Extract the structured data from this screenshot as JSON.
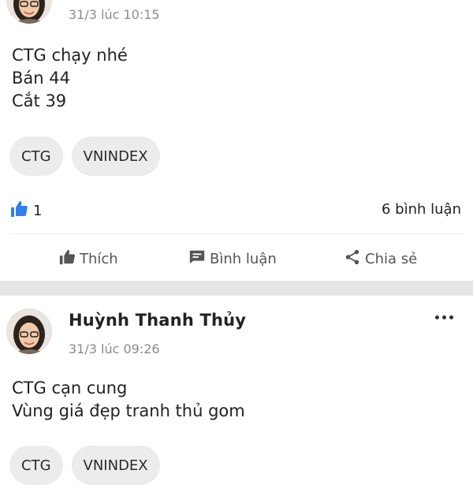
{
  "posts": [
    {
      "time": "31/3 lúc 10:15",
      "content_lines": [
        "CTG chạy nhé",
        "Bán 44",
        "Cắt 39"
      ],
      "tags": [
        "CTG",
        "VNINDEX"
      ],
      "like_count": "1",
      "comment_count": "6 bình luận",
      "actions": {
        "like": "Thích",
        "comment": "Bình luận",
        "share": "Chia sẻ"
      }
    },
    {
      "author": "Huỳnh Thanh Thủy",
      "time": "31/3 lúc 09:26",
      "content_lines": [
        "CTG cạn cung",
        "Vùng giá đẹp tranh thủ gom"
      ],
      "tags": [
        "CTG",
        "VNINDEX"
      ]
    }
  ],
  "icons": {
    "like": "thumbs-up-icon",
    "comment": "comment-icon",
    "share": "share-icon",
    "more": "more-options-icon"
  },
  "colors": {
    "like_accent": "#2f80ed",
    "action_grey": "#555555",
    "separator": "#e6e6e6",
    "tag_bg": "#ececec"
  }
}
